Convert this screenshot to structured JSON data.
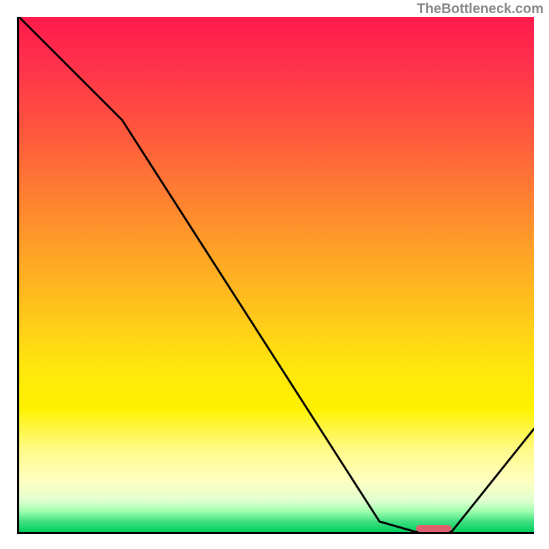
{
  "watermark": "TheBottleneck.com",
  "chart_data": {
    "type": "line",
    "title": "",
    "xlabel": "",
    "ylabel": "",
    "xlim": [
      0,
      100
    ],
    "ylim": [
      0,
      100
    ],
    "series": [
      {
        "name": "curve",
        "x": [
          0,
          20,
          70,
          77,
          84,
          100
        ],
        "values": [
          100,
          80,
          2,
          0,
          0,
          20
        ]
      }
    ],
    "marker": {
      "x_start": 77,
      "x_end": 84,
      "y": 0
    },
    "gradient": {
      "stops": [
        {
          "pos": 0,
          "color": "#ff1a4a"
        },
        {
          "pos": 8,
          "color": "#ff2e4d"
        },
        {
          "pos": 20,
          "color": "#ff5040"
        },
        {
          "pos": 33,
          "color": "#ff7a33"
        },
        {
          "pos": 46,
          "color": "#ffa326"
        },
        {
          "pos": 58,
          "color": "#ffc71a"
        },
        {
          "pos": 68,
          "color": "#ffe60d"
        },
        {
          "pos": 76,
          "color": "#fff200"
        },
        {
          "pos": 84,
          "color": "#fffa88"
        },
        {
          "pos": 90,
          "color": "#ffffc0"
        },
        {
          "pos": 94,
          "color": "#e0ffd0"
        },
        {
          "pos": 96,
          "color": "#a0ffb0"
        },
        {
          "pos": 98,
          "color": "#40e080"
        },
        {
          "pos": 100,
          "color": "#00d060"
        }
      ]
    }
  }
}
